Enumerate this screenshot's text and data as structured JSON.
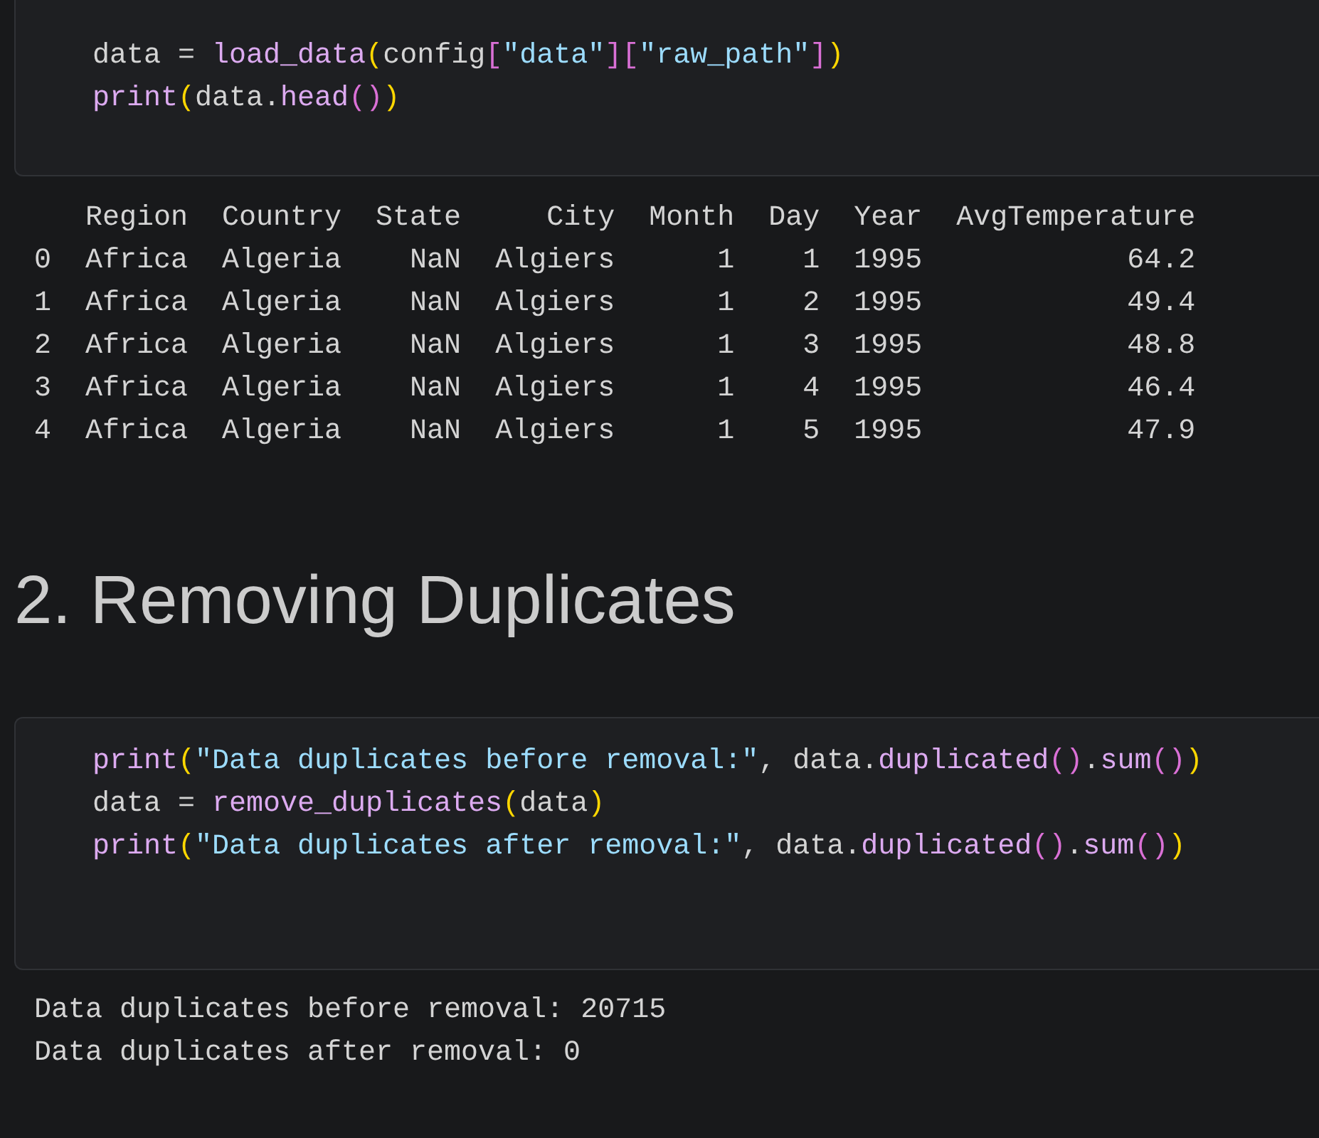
{
  "cells": [
    {
      "kind": "code",
      "lines": [
        [
          {
            "kind": "plain",
            "text": "data = "
          },
          {
            "kind": "func",
            "text": "load_data"
          },
          {
            "kind": "bracket_1",
            "text": "("
          },
          {
            "kind": "plain",
            "text": "config"
          },
          {
            "kind": "bracket_2",
            "text": "["
          },
          {
            "kind": "string",
            "text": "\"data\""
          },
          {
            "kind": "bracket_2",
            "text": "]["
          },
          {
            "kind": "string",
            "text": "\"raw_path\""
          },
          {
            "kind": "bracket_2",
            "text": "]"
          },
          {
            "kind": "bracket_1",
            "text": ")"
          }
        ],
        [
          {
            "kind": "func",
            "text": "print"
          },
          {
            "kind": "bracket_1",
            "text": "("
          },
          {
            "kind": "plain",
            "text": "data."
          },
          {
            "kind": "func",
            "text": "head"
          },
          {
            "kind": "bracket_2",
            "text": "()"
          },
          {
            "kind": "bracket_1",
            "text": ")"
          }
        ]
      ]
    },
    {
      "kind": "table_output",
      "columns": [
        "Region",
        "Country",
        "State",
        "City",
        "Month",
        "Day",
        "Year",
        "AvgTemperature"
      ],
      "rows": [
        {
          "index": "0",
          "cells": [
            "Africa",
            "Algeria",
            "NaN",
            "Algiers",
            "1",
            "1",
            "1995",
            "64.2"
          ]
        },
        {
          "index": "1",
          "cells": [
            "Africa",
            "Algeria",
            "NaN",
            "Algiers",
            "1",
            "2",
            "1995",
            "49.4"
          ]
        },
        {
          "index": "2",
          "cells": [
            "Africa",
            "Algeria",
            "NaN",
            "Algiers",
            "1",
            "3",
            "1995",
            "48.8"
          ]
        },
        {
          "index": "3",
          "cells": [
            "Africa",
            "Algeria",
            "NaN",
            "Algiers",
            "1",
            "4",
            "1995",
            "46.4"
          ]
        },
        {
          "index": "4",
          "cells": [
            "Africa",
            "Algeria",
            "NaN",
            "Algiers",
            "1",
            "5",
            "1995",
            "47.9"
          ]
        }
      ]
    },
    {
      "kind": "heading",
      "text": "2. Removing Duplicates"
    },
    {
      "kind": "code",
      "lines": [
        [
          {
            "kind": "func",
            "text": "print"
          },
          {
            "kind": "bracket_1",
            "text": "("
          },
          {
            "kind": "string",
            "text": "\"Data duplicates before removal:\""
          },
          {
            "kind": "plain",
            "text": ", data."
          },
          {
            "kind": "func",
            "text": "duplicated"
          },
          {
            "kind": "bracket_2",
            "text": "()"
          },
          {
            "kind": "plain",
            "text": "."
          },
          {
            "kind": "func",
            "text": "sum"
          },
          {
            "kind": "bracket_2",
            "text": "()"
          },
          {
            "kind": "bracket_1",
            "text": ")"
          }
        ],
        [
          {
            "kind": "plain",
            "text": "data = "
          },
          {
            "kind": "func",
            "text": "remove_duplicates"
          },
          {
            "kind": "bracket_1",
            "text": "("
          },
          {
            "kind": "plain",
            "text": "data"
          },
          {
            "kind": "bracket_1",
            "text": ")"
          }
        ],
        [
          {
            "kind": "func",
            "text": "print"
          },
          {
            "kind": "bracket_1",
            "text": "("
          },
          {
            "kind": "string",
            "text": "\"Data duplicates after removal:\""
          },
          {
            "kind": "plain",
            "text": ", data."
          },
          {
            "kind": "func",
            "text": "duplicated"
          },
          {
            "kind": "bracket_2",
            "text": "()"
          },
          {
            "kind": "plain",
            "text": "."
          },
          {
            "kind": "func",
            "text": "sum"
          },
          {
            "kind": "bracket_2",
            "text": "()"
          },
          {
            "kind": "bracket_1",
            "text": ")"
          }
        ]
      ]
    },
    {
      "kind": "stream_output",
      "lines": [
        "Data duplicates before removal: 20715",
        "Data duplicates after removal: 0"
      ]
    }
  ]
}
